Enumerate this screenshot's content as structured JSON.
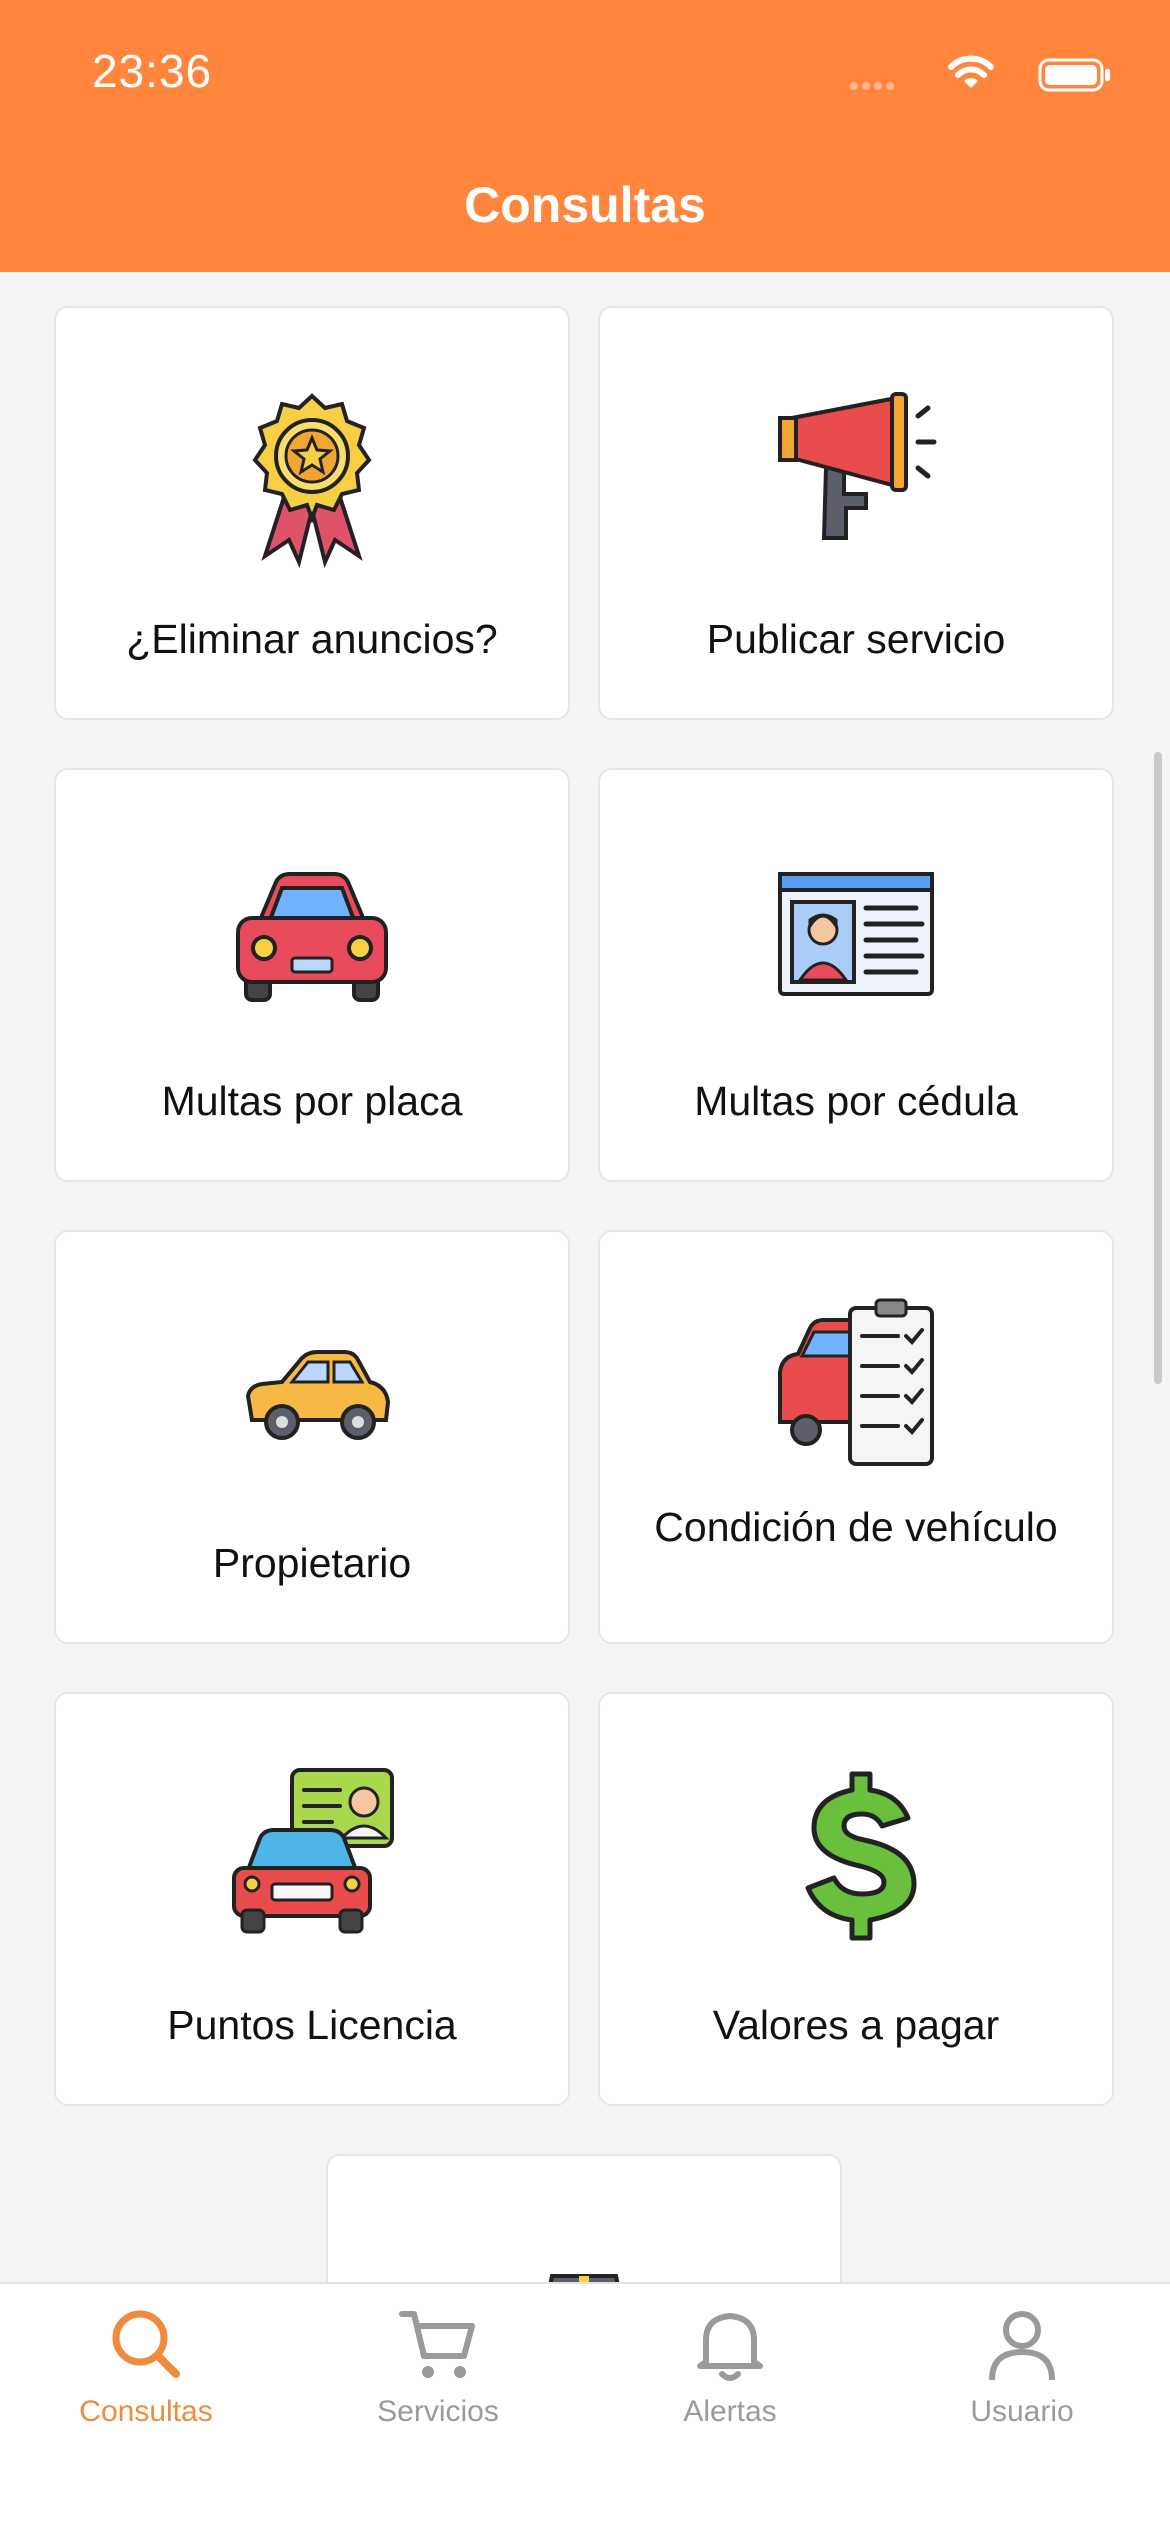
{
  "status_bar": {
    "time": "23:36"
  },
  "header": {
    "title": "Consultas"
  },
  "cards": [
    {
      "label": "¿Eliminar anuncios?",
      "icon": "award-medal-icon"
    },
    {
      "label": "Publicar servicio",
      "icon": "megaphone-icon"
    },
    {
      "label": "Multas por placa",
      "icon": "red-car-front-icon"
    },
    {
      "label": "Multas por cédula",
      "icon": "id-card-icon"
    },
    {
      "label": "Propietario",
      "icon": "yellow-car-icon"
    },
    {
      "label": "Condición de vehículo",
      "icon": "car-checklist-icon"
    },
    {
      "label": "Puntos Licencia",
      "icon": "car-license-icon"
    },
    {
      "label": "Valores a pagar",
      "icon": "dollar-sign-icon"
    },
    {
      "label": "",
      "icon": "road-icon"
    }
  ],
  "tabbar": {
    "active_color": "#f08a3c",
    "inactive_color": "#9a9a9a",
    "tabs": [
      {
        "label": "Consultas",
        "icon": "search-icon",
        "active": true
      },
      {
        "label": "Servicios",
        "icon": "cart-icon",
        "active": false
      },
      {
        "label": "Alertas",
        "icon": "bell-icon",
        "active": false
      },
      {
        "label": "Usuario",
        "icon": "user-icon",
        "active": false
      }
    ]
  },
  "colors": {
    "header": "#ff863c",
    "background": "#f4f4f4"
  }
}
